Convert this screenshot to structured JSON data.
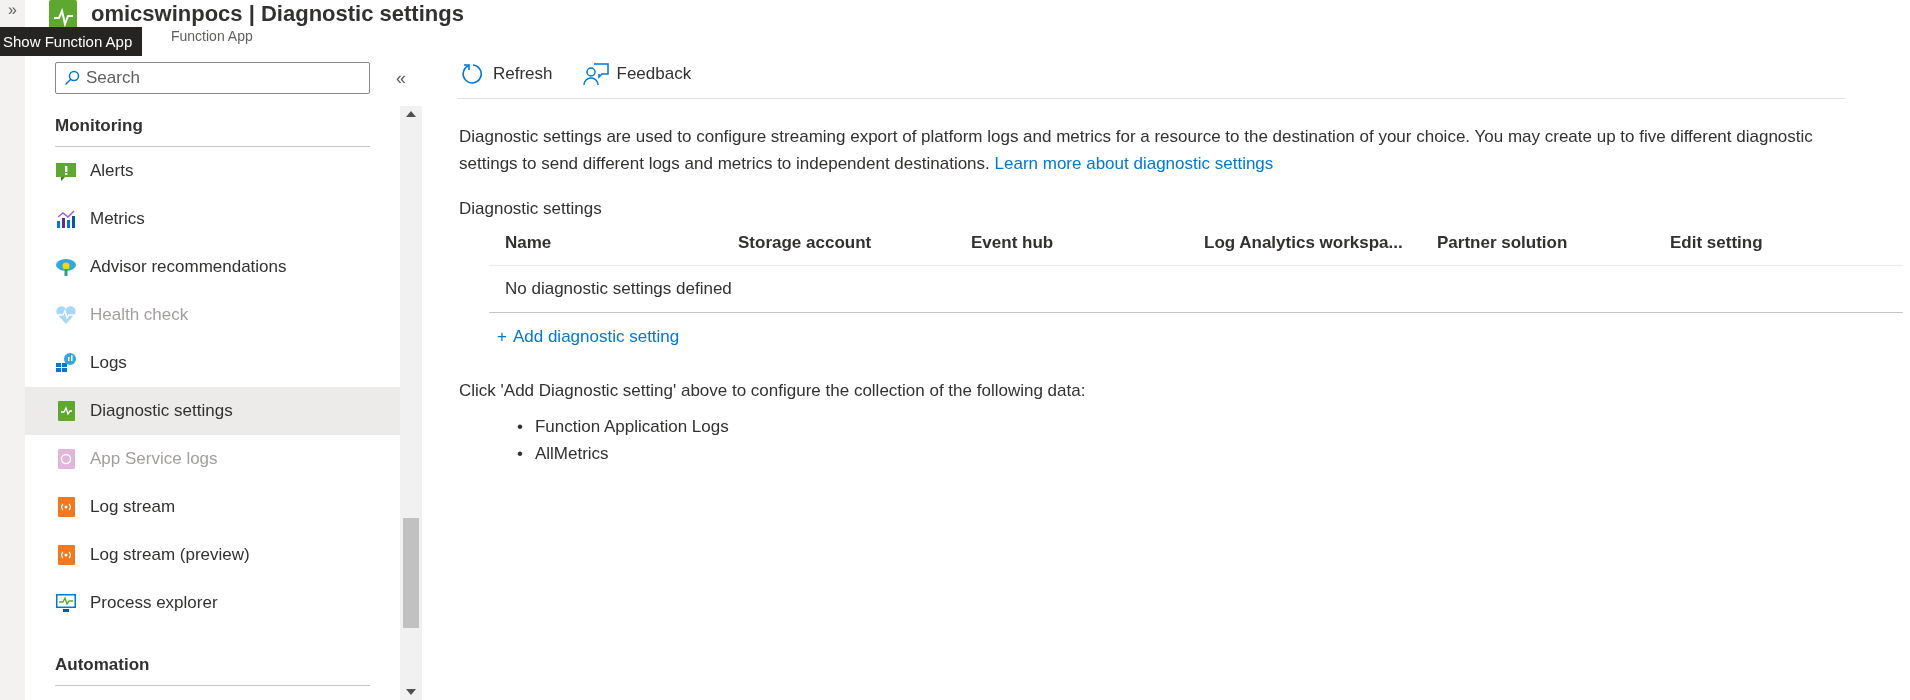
{
  "header": {
    "title": "omicswinpocs | Diagnostic settings",
    "subtitle": "Function App",
    "tooltip": "Show Function App",
    "expand_glyph": "»"
  },
  "sidebar": {
    "search": {
      "placeholder": "Search"
    },
    "collapse_glyph": "«",
    "sections": [
      {
        "title": "Monitoring",
        "items": [
          {
            "label": "Alerts",
            "selected": false,
            "disabled": false
          },
          {
            "label": "Metrics",
            "selected": false,
            "disabled": false
          },
          {
            "label": "Advisor recommendations",
            "selected": false,
            "disabled": false
          },
          {
            "label": "Health check",
            "selected": false,
            "disabled": true
          },
          {
            "label": "Logs",
            "selected": false,
            "disabled": false
          },
          {
            "label": "Diagnostic settings",
            "selected": true,
            "disabled": false
          },
          {
            "label": "App Service logs",
            "selected": false,
            "disabled": true
          },
          {
            "label": "Log stream",
            "selected": false,
            "disabled": false
          },
          {
            "label": "Log stream (preview)",
            "selected": false,
            "disabled": false
          },
          {
            "label": "Process explorer",
            "selected": false,
            "disabled": false
          }
        ]
      },
      {
        "title": "Automation"
      }
    ]
  },
  "toolbar": [
    {
      "label": "Refresh"
    },
    {
      "label": "Feedback"
    }
  ],
  "description": "Diagnostic settings are used to configure streaming export of platform logs and metrics for a resource to the destination of your choice. You may create up to five different diagnostic settings to send different logs and metrics to independent destinations.",
  "learn_more": "Learn more about diagnostic settings",
  "table": {
    "caption": "Diagnostic settings",
    "columns": [
      "Name",
      "Storage account",
      "Event hub",
      "Log Analytics workspa...",
      "Partner solution",
      "Edit setting"
    ],
    "empty_message": "No diagnostic settings defined"
  },
  "add_link": {
    "glyph": "+",
    "label": "Add diagnostic setting"
  },
  "instructions": "Click 'Add Diagnostic setting' above to configure the collection of the following data:",
  "data_items": [
    {
      "bullet": "•",
      "label": "Function Application Logs"
    },
    {
      "bullet": "•",
      "label": "AllMetrics"
    }
  ]
}
